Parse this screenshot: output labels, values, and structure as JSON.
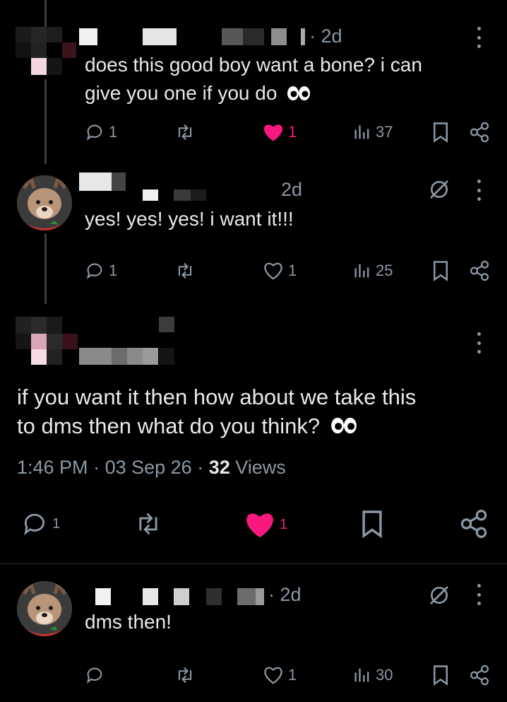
{
  "posts": [
    {
      "timestamp": "· 2d",
      "text_line1": "does this good boy want a bone? i can",
      "text_line2": "give you one if you do",
      "emoji_icon": "eyes-icon",
      "replies": "1",
      "likes": "1",
      "views": "37"
    },
    {
      "timestamp": "2d",
      "text": "yes! yes! yes! i want it!!!",
      "replies": "1",
      "likes": "1",
      "views": "25",
      "badge_icon": "grok-icon"
    }
  ],
  "main": {
    "text_line1": "if you want it then how about we take this",
    "text_line2": "to dms then what do you think?",
    "emoji_icon": "eyes-icon",
    "time": "1:46 PM",
    "date": "03 Sep 26",
    "views_count": "32",
    "views_label": "Views",
    "replies": "1",
    "likes": "1",
    "like_color": "#f91880"
  },
  "reply": {
    "timestamp": "· 2d",
    "text": "dms then!",
    "likes": "1",
    "views": "30",
    "badge_icon": "grok-icon"
  },
  "colors": {
    "muted": "#8b98a5",
    "like": "#f91880",
    "text": "#e7e9ea",
    "background": "#000000"
  }
}
